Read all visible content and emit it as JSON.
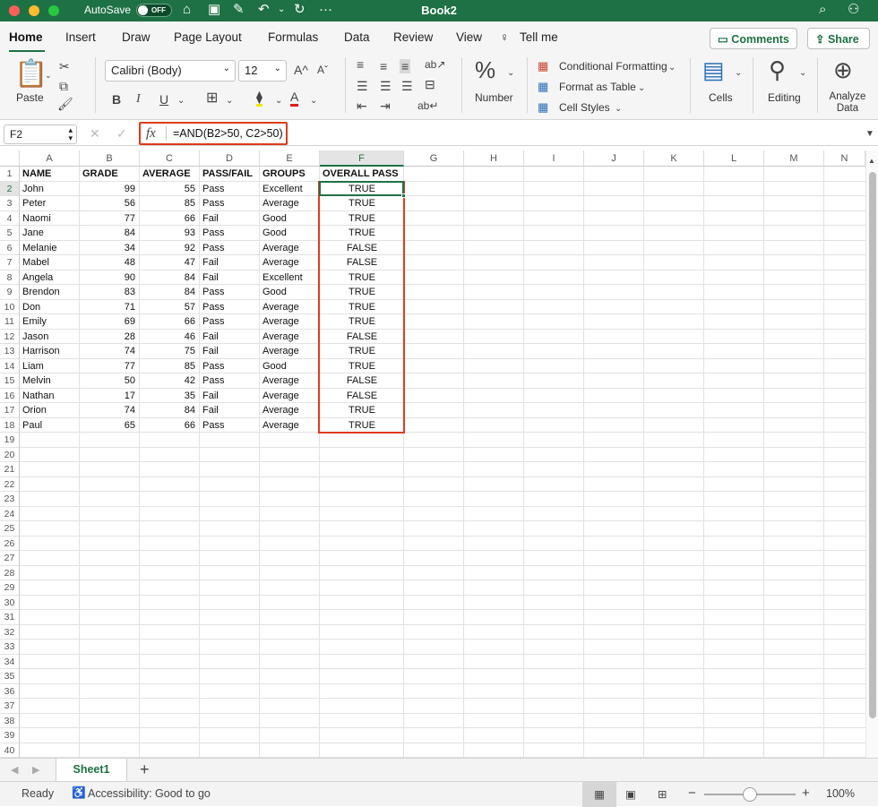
{
  "titlebar": {
    "autosave_label": "AutoSave",
    "toggle_state": "OFF",
    "title": "Book2"
  },
  "tabs": [
    "Home",
    "Insert",
    "Draw",
    "Page Layout",
    "Formulas",
    "Data",
    "Review",
    "View",
    "Tell me"
  ],
  "actions": {
    "comments": "Comments",
    "share": "Share"
  },
  "ribbon": {
    "paste": "Paste",
    "font_name": "Calibri (Body)",
    "font_size": "12",
    "bold": "B",
    "italic": "I",
    "underline": "U",
    "number": "Number",
    "conditional_formatting": "Conditional Formatting",
    "format_as_table": "Format as Table",
    "cell_styles": "Cell Styles",
    "cells": "Cells",
    "editing": "Editing",
    "analyze_data": "Analyze Data"
  },
  "formula_bar": {
    "name_box": "F2",
    "fx": "fx",
    "formula": "=AND(B2>50, C2>50)"
  },
  "columns": [
    "A",
    "B",
    "C",
    "D",
    "E",
    "F",
    "G",
    "H",
    "I",
    "J",
    "K",
    "L",
    "M",
    "N"
  ],
  "row_numbers": [
    "1",
    "2",
    "3",
    "4",
    "5",
    "6",
    "7",
    "8",
    "9",
    "10",
    "11",
    "12",
    "13",
    "14",
    "15",
    "16",
    "17",
    "18",
    "19",
    "20",
    "21",
    "22",
    "23",
    "24",
    "25",
    "26",
    "27",
    "28",
    "29",
    "30",
    "31",
    "32",
    "33",
    "34",
    "35",
    "36",
    "37",
    "38",
    "39",
    "40"
  ],
  "headers": [
    "NAME",
    "GRADE",
    "AVERAGE",
    "PASS/FAIL",
    "GROUPS",
    "OVERALL PASS"
  ],
  "rows": [
    [
      "John",
      "99",
      "55",
      "Pass",
      "Excellent",
      "TRUE"
    ],
    [
      "Peter",
      "56",
      "85",
      "Pass",
      "Average",
      "TRUE"
    ],
    [
      "Naomi",
      "77",
      "66",
      "Fail",
      "Good",
      "TRUE"
    ],
    [
      "Jane",
      "84",
      "93",
      "Pass",
      "Good",
      "TRUE"
    ],
    [
      "Melanie",
      "34",
      "92",
      "Pass",
      "Average",
      "FALSE"
    ],
    [
      "Mabel",
      "48",
      "47",
      "Fail",
      "Average",
      "FALSE"
    ],
    [
      "Angela",
      "90",
      "84",
      "Fail",
      "Excellent",
      "TRUE"
    ],
    [
      "Brendon",
      "83",
      "84",
      "Pass",
      "Good",
      "TRUE"
    ],
    [
      "Don",
      "71",
      "57",
      "Pass",
      "Average",
      "TRUE"
    ],
    [
      "Emily",
      "69",
      "66",
      "Pass",
      "Average",
      "TRUE"
    ],
    [
      "Jason",
      "28",
      "46",
      "Fail",
      "Average",
      "FALSE"
    ],
    [
      "Harrison",
      "74",
      "75",
      "Fail",
      "Average",
      "TRUE"
    ],
    [
      "Liam",
      "77",
      "85",
      "Pass",
      "Good",
      "TRUE"
    ],
    [
      "Melvin",
      "50",
      "42",
      "Pass",
      "Average",
      "FALSE"
    ],
    [
      "Nathan",
      "17",
      "35",
      "Fail",
      "Average",
      "FALSE"
    ],
    [
      "Orion",
      "74",
      "84",
      "Fail",
      "Average",
      "TRUE"
    ],
    [
      "Paul",
      "65",
      "66",
      "Pass",
      "Average",
      "TRUE"
    ]
  ],
  "sheet_tab": "Sheet1",
  "status": {
    "ready": "Ready",
    "accessibility": "Accessibility: Good to go",
    "zoom": "100%"
  },
  "colors": {
    "excel_green": "#1e7145",
    "highlight_red": "#e03b1c"
  }
}
